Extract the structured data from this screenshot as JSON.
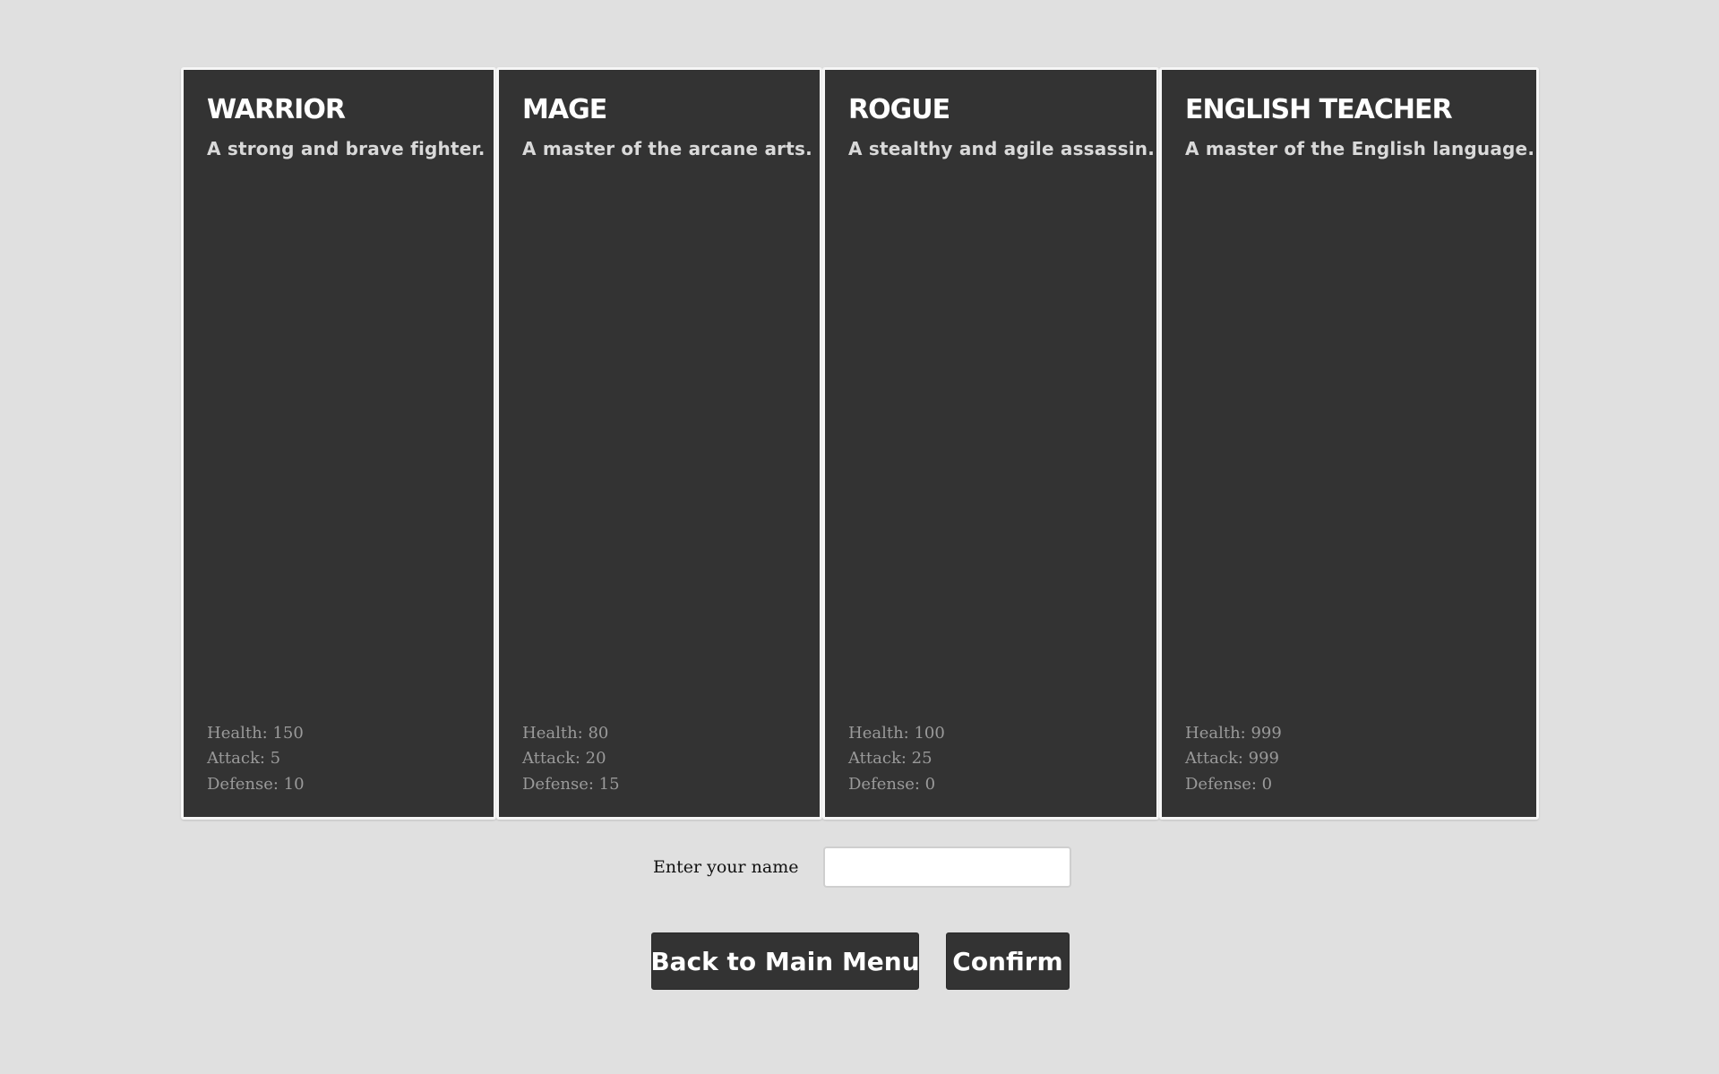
{
  "classes": [
    {
      "name": "WARRIOR",
      "description": "A strong and brave fighter.",
      "health": "Health: 150",
      "attack": "Attack: 5",
      "defense": "Defense: 10"
    },
    {
      "name": "MAGE",
      "description": "A master of the arcane arts.",
      "health": "Health: 80",
      "attack": "Attack: 20",
      "defense": "Defense: 15"
    },
    {
      "name": "ROGUE",
      "description": "A stealthy and agile assassin.",
      "health": "Health: 100",
      "attack": "Attack: 25",
      "defense": "Defense: 0"
    },
    {
      "name": "ENGLISH TEACHER",
      "description": "A master of the English language.",
      "health": "Health: 999",
      "attack": "Attack: 999",
      "defense": "Defense: 0"
    }
  ],
  "name_entry": {
    "label": "Enter your name",
    "value": "",
    "placeholder": ""
  },
  "buttons": {
    "back": "Back to Main Menu",
    "confirm": "Confirm"
  },
  "colors": {
    "background": "#e0e0e0",
    "card": "#333333",
    "card_border": "#f6f6f6",
    "title_text": "#ffffff",
    "stat_text": "#9a9a9a"
  }
}
